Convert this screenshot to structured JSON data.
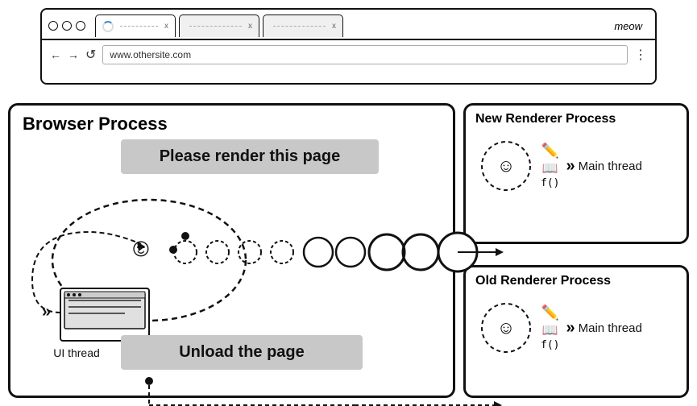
{
  "browser_chrome": {
    "tab1": {
      "loading": true,
      "text_line": "- - - - - - - -",
      "close": "x"
    },
    "tab2": {
      "text_line": "- - - - - -",
      "close": "x"
    },
    "tab3": {
      "text_line": "- - - -",
      "close": "x"
    },
    "tab_extra": "meow",
    "address": "www.othersite.com",
    "back": "←",
    "forward": "→",
    "refresh": "c",
    "menu": "⋮"
  },
  "diagram": {
    "browser_process_title": "Browser Process",
    "new_renderer_title": "New Renderer Process",
    "old_renderer_title": "Old Renderer Process",
    "render_banner": "Please render this page",
    "unload_banner": "Unload the page",
    "ui_thread_label": "UI thread",
    "main_thread_label": "Main thread"
  }
}
